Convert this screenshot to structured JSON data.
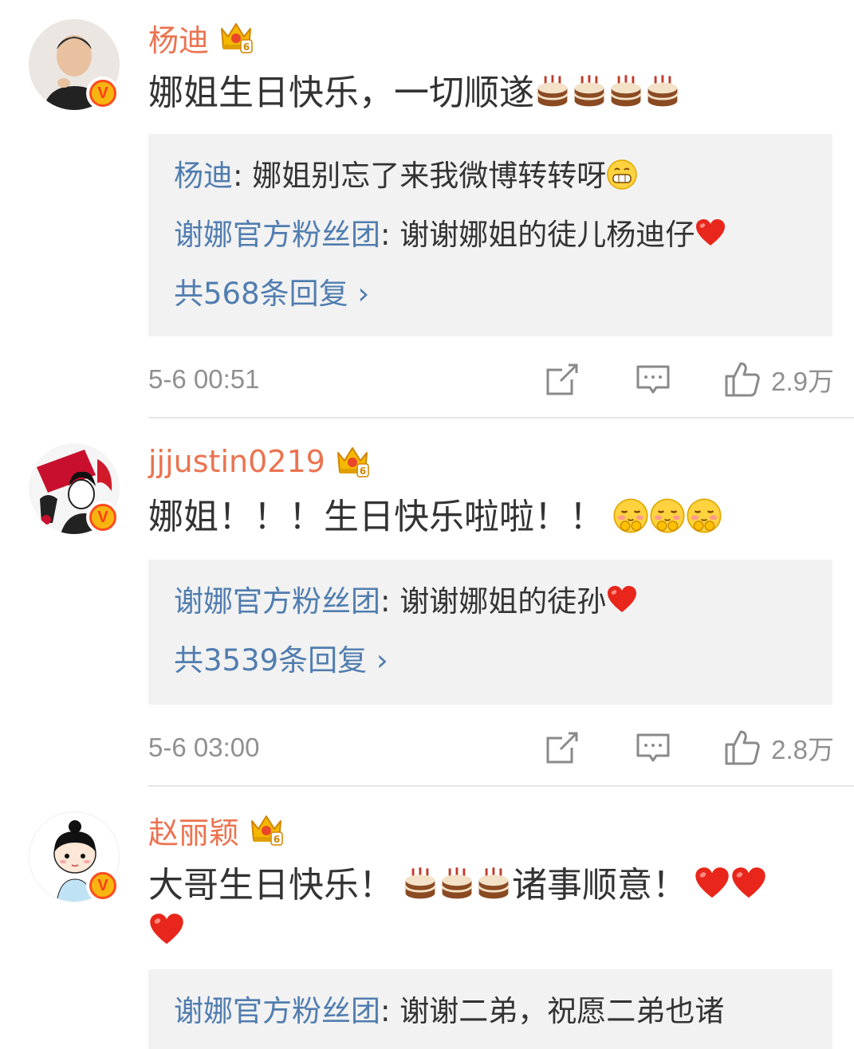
{
  "comments": [
    {
      "name": "杨迪",
      "text": "娜姐生日快乐，一切顺遂",
      "text_emojis": [
        "cake",
        "cake",
        "cake",
        "cake"
      ],
      "replies": [
        {
          "user": "杨迪",
          "sep": ": ",
          "text": "娜姐别忘了来我微博转转呀",
          "emoji": "grin"
        },
        {
          "user": "谢娜官方粉丝团",
          "sep": ": ",
          "text": "谢谢娜姐的徒儿杨迪仔",
          "emoji": "heart"
        }
      ],
      "more_replies": "共568条回复 ›",
      "time": "5-6 00:51",
      "likes": "2.9万"
    },
    {
      "name": "jjjustin0219",
      "text": "娜姐！！！生日快乐啦啦！！",
      "text_emojis": [
        "shy",
        "shy",
        "shy"
      ],
      "replies": [
        {
          "user": "谢娜官方粉丝团",
          "sep": ": ",
          "text": "谢谢娜姐的徒孙",
          "emoji": "heart"
        }
      ],
      "more_replies": "共3539条回复 ›",
      "time": "5-6 03:00",
      "likes": "2.8万"
    },
    {
      "name": "赵丽颖",
      "text_part1": "大哥生日快乐！",
      "text_part2": "诸事顺意！",
      "replies": [
        {
          "user": "谢娜官方粉丝团",
          "sep": ": ",
          "text": "谢谢二弟，祝愿二弟也诸"
        }
      ]
    }
  ],
  "icons": {
    "verified_badge": "V",
    "share": "share-icon",
    "comment": "comment-icon",
    "like": "thumbs-up-icon",
    "crown": "crown-icon"
  },
  "colors": {
    "username": "#eb7350",
    "reply_user": "#507daf",
    "meta": "#909090",
    "reply_bg": "#f2f2f2"
  }
}
